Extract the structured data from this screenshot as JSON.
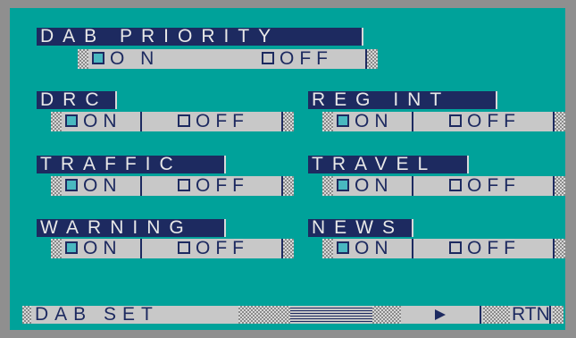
{
  "screen_title": "DAB SET",
  "dab_priority": {
    "label": "DAB PRIORITY",
    "on_label": "O N",
    "off_label": "OFF",
    "selected": "on"
  },
  "drc": {
    "label": "DRC",
    "on_label": "ON",
    "off_label": "OFF",
    "selected": "on"
  },
  "reg_int": {
    "label": "REG INT",
    "on_label": "ON",
    "off_label": "OFF",
    "selected": "on"
  },
  "traffic": {
    "label": "TRAFFIC",
    "on_label": "ON",
    "off_label": "OFF",
    "selected": "on"
  },
  "travel": {
    "label": "TRAVEL",
    "on_label": "ON",
    "off_label": "OFF",
    "selected": "on"
  },
  "warning": {
    "label": "WARNING",
    "on_label": "ON",
    "off_label": "OFF",
    "selected": "on"
  },
  "news": {
    "label": "NEWS",
    "on_label": "ON",
    "off_label": "OFF",
    "selected": "on"
  },
  "bottom_bar": {
    "next_icon": "play-arrow-icon",
    "rtn_label": "RTN"
  },
  "colors": {
    "background": "#00a29a",
    "title_bg": "#1d2a60",
    "option_bg": "#c8c8c8",
    "checked": "#49b8c0"
  }
}
